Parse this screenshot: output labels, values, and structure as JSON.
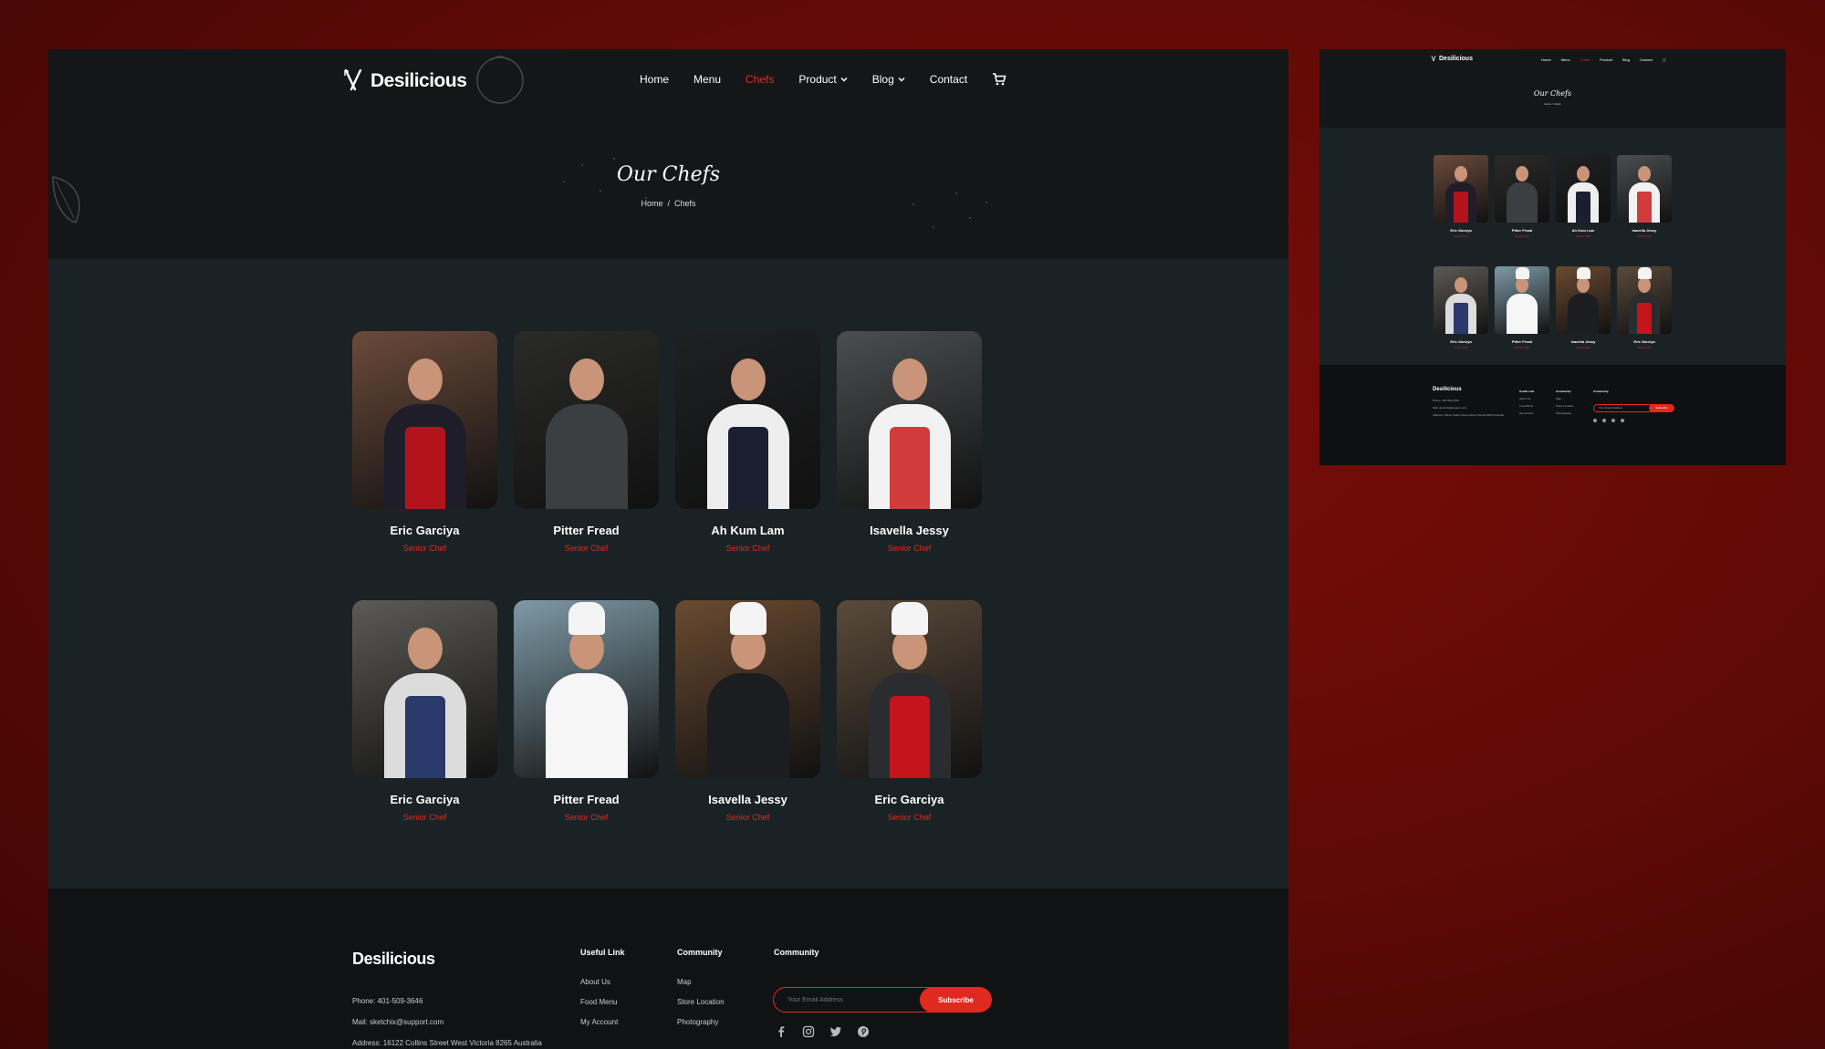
{
  "brand": {
    "name": "Desilicious"
  },
  "nav": {
    "items": [
      {
        "label": "Home",
        "active": false,
        "dropdown": false
      },
      {
        "label": "Menu",
        "active": false,
        "dropdown": false
      },
      {
        "label": "Chefs",
        "active": true,
        "dropdown": false
      },
      {
        "label": "Product",
        "active": false,
        "dropdown": true
      },
      {
        "label": "Blog",
        "active": false,
        "dropdown": true
      },
      {
        "label": "Contact",
        "active": false,
        "dropdown": false
      }
    ],
    "cart_icon": "cart-icon"
  },
  "hero": {
    "title": "Our Chefs",
    "breadcrumb": {
      "home": "Home",
      "separator": "/",
      "current": "Chefs"
    }
  },
  "chefs": [
    {
      "name": "Eric Garciya",
      "role": "Senior Chef",
      "bg": "#6b4a3a",
      "shirt": "#1f1d2a",
      "apron": "#b3141c",
      "hat": false
    },
    {
      "name": "Pitter Fread",
      "role": "Senior Chef",
      "bg": "#2a2a28",
      "shirt": "#3b3f42",
      "apron": "#3b3f42",
      "hat": false
    },
    {
      "name": "Ah Kum Lam",
      "role": "Senior Chef",
      "bg": "#1e2022",
      "shirt": "#eeeeee",
      "apron": "#1b2030",
      "hat": false
    },
    {
      "name": "Isavella Jessy",
      "role": "Senior Chef",
      "bg": "#4a4e50",
      "shirt": "#f2f2f2",
      "apron": "#d23b3b",
      "hat": false
    },
    {
      "name": "Eric Garciya",
      "role": "Senior Chef",
      "bg": "#5c5a55",
      "shirt": "#dcdcdc",
      "apron": "#2a3a6a",
      "hat": false
    },
    {
      "name": "Pitter Fread",
      "role": "Senior Chef",
      "bg": "#7e9aa6",
      "shirt": "#f6f6f6",
      "apron": "#f6f6f6",
      "hat": true
    },
    {
      "name": "Isavella Jessy",
      "role": "Senior Chef",
      "bg": "#6a4a30",
      "shirt": "#1b1d20",
      "apron": "#1b1d20",
      "hat": true
    },
    {
      "name": "Eric Garciya",
      "role": "Senior Chef",
      "bg": "#5a4a3a",
      "shirt": "#2a2c30",
      "apron": "#c4151d",
      "hat": true
    }
  ],
  "footer": {
    "logo": "Desilicious",
    "phone": "Phone: 401-509-3646",
    "mail": "Mail: sketchix@support.com",
    "address": "Address: 16122 Collins Street West Victoria 8265 Australia",
    "useful_link": {
      "heading": "Useful Link",
      "links": [
        "About Us",
        "Food Menu",
        "My Account"
      ]
    },
    "community": {
      "heading": "Community",
      "links": [
        "Map",
        "Store Location",
        "Photography"
      ]
    },
    "newsletter": {
      "heading": "Community",
      "placeholder": "Your Email Address",
      "button": "Subscribe"
    },
    "social": [
      "facebook-icon",
      "instagram-icon",
      "twitter-icon",
      "pinterest-icon"
    ]
  },
  "colors": {
    "accent": "#e02a1f",
    "page_bg": "#5e0a06",
    "section_bg": "#1b2225",
    "header_bg": "#141617",
    "footer_bg": "#101214"
  }
}
